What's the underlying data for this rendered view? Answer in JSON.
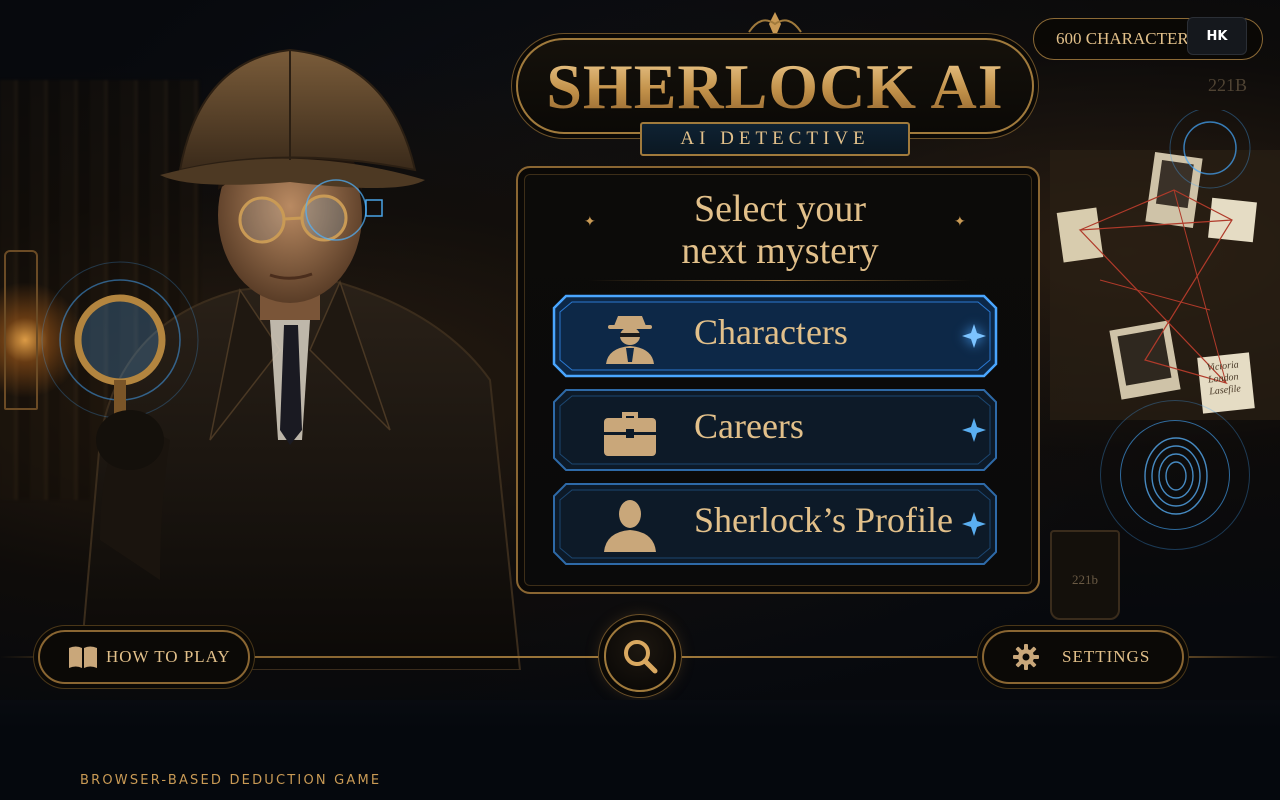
{
  "app": {
    "title": "SHERLOCK AI",
    "subtitle": "AI DETECTIVE",
    "character_count_label": "600 CHARACTERS",
    "language_code": "HK"
  },
  "panel": {
    "heading_line1": "Select your",
    "heading_line2": "next mystery",
    "menu": [
      {
        "label": "Characters",
        "icon": "detective-silhouette-icon",
        "active": true
      },
      {
        "label": "Careers",
        "icon": "briefcase-icon",
        "active": false
      },
      {
        "label": "Sherlock’s Profile",
        "icon": "person-silhouette-icon",
        "active": false
      }
    ]
  },
  "bottom_bar": {
    "how_to_play": "HOW TO PLAY",
    "settings": "SETTINGS"
  },
  "scene": {
    "board_number": "221B",
    "mug_label": "221b",
    "note_text": "Victoria London Lasefile"
  },
  "footer": {
    "tagline": "BROWSER-BASED DEDUCTION GAME"
  },
  "colors": {
    "gold": "#e2c08a",
    "frame": "#8a6632",
    "active_glow": "#3b9cff",
    "background": "#05080d"
  }
}
